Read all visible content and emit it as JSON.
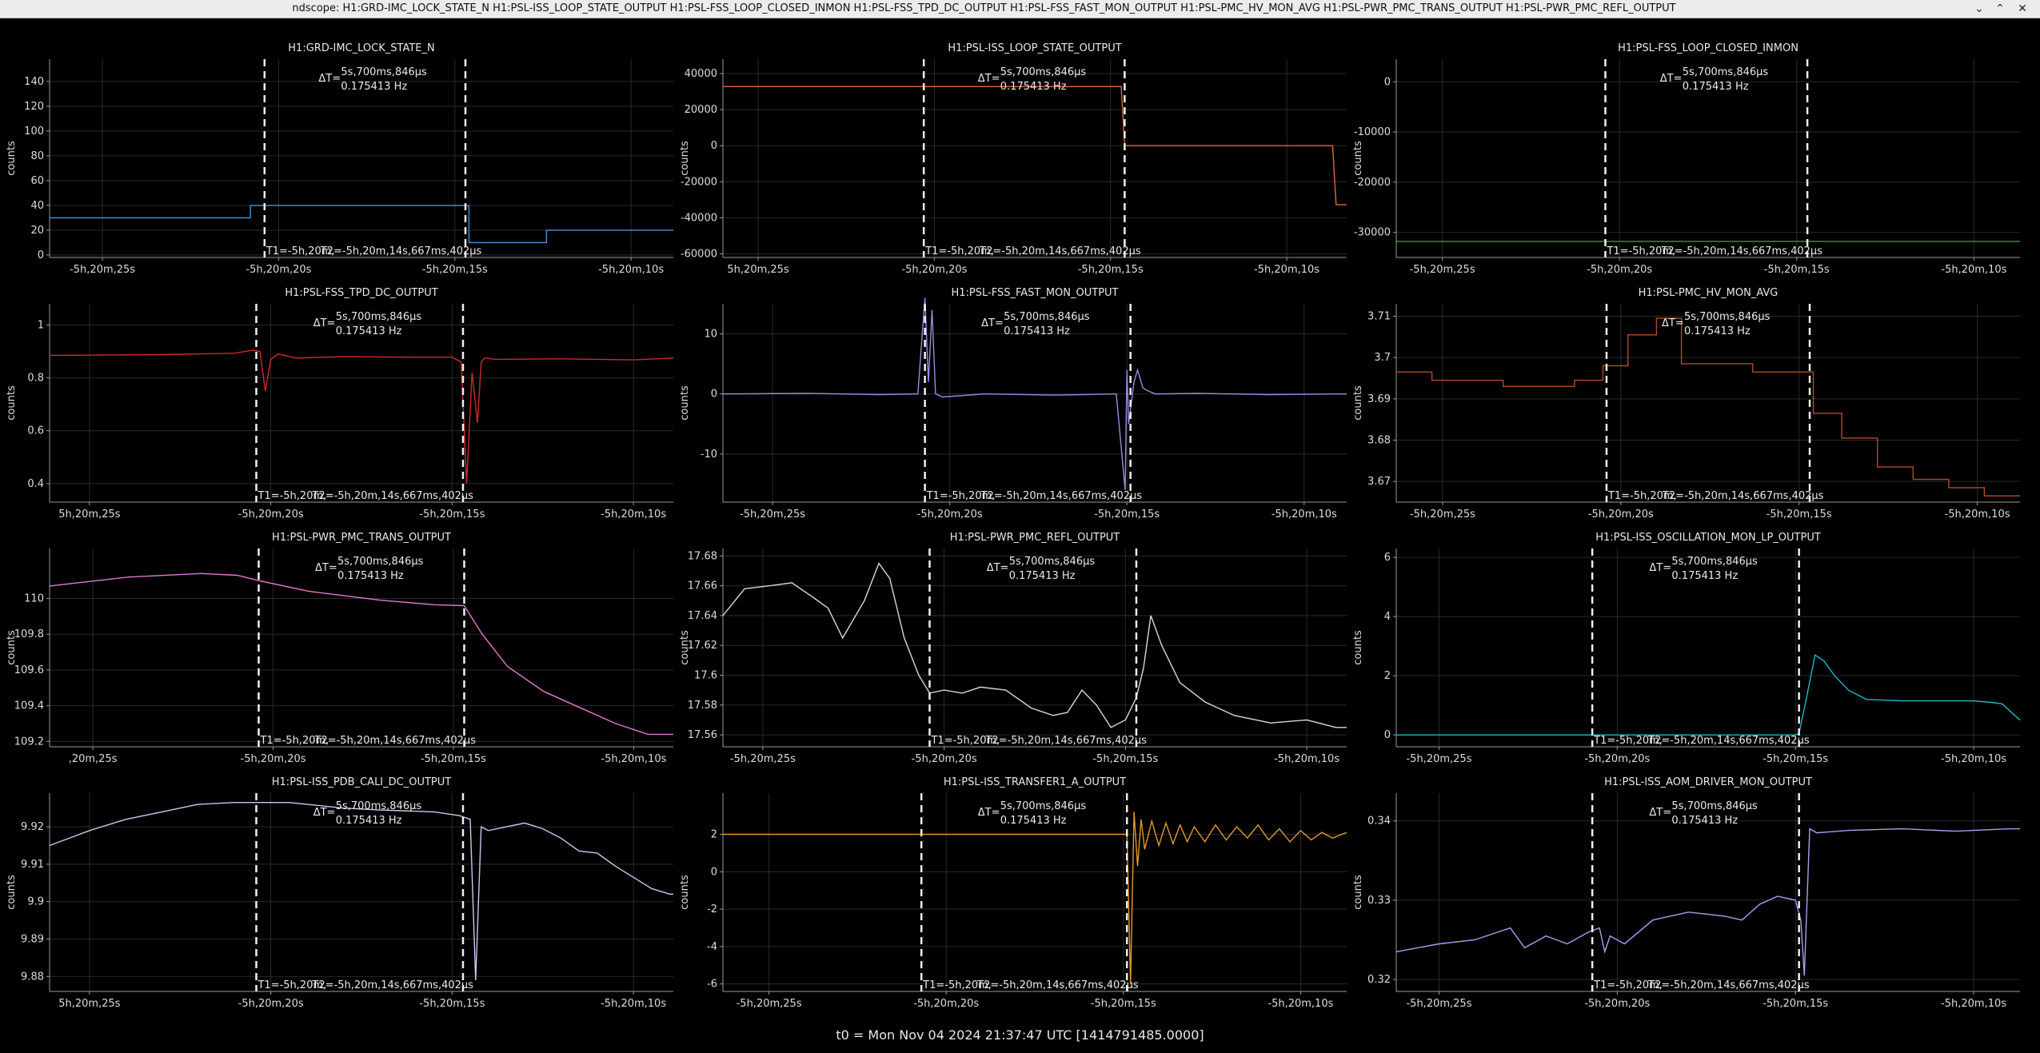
{
  "window": {
    "title": "ndscope: H1:GRD-IMC_LOCK_STATE_N H1:PSL-ISS_LOOP_STATE_OUTPUT H1:PSL-FSS_LOOP_CLOSED_INMON H1:PSL-FSS_TPD_DC_OUTPUT H1:PSL-FSS_FAST_MON_OUTPUT H1:PSL-PMC_HV_MON_AVG H1:PSL-PWR_PMC_TRANS_OUTPUT H1:PSL-PWR_PMC_REFL_OUTPUT",
    "buttons": {
      "minimize": "⌄",
      "maximize": "⌃",
      "close": "✕"
    }
  },
  "cursor_labels": {
    "dt_label": "ΔT=",
    "dt_value": "5s,700ms,846μs",
    "freq_value": "0.175413 Hz",
    "t1_label": "T1=-5h,20m,",
    "t2_label": "T2=-5h,20m,14s,667ms,402μs"
  },
  "footer": "t0 = Mon Nov 04 2024 21:37:47 UTC [1414791485.0000]",
  "chart_data": [
    {
      "type": "line",
      "title": "H1:GRD-IMC_LOCK_STATE_N",
      "ylabel": "counts",
      "color": "#4a90d9",
      "step": true,
      "ylim": [
        -2,
        158
      ],
      "yticks": [
        0,
        20,
        40,
        60,
        80,
        100,
        120,
        140
      ],
      "xlim": [
        -26.5,
        -8.8
      ],
      "xticks": [
        -25,
        -20,
        -15,
        -10
      ],
      "xtick_labels": [
        "-5h,20m,25s",
        "-5h,20m,20s",
        "-5h,20m,15s",
        "-5h,20m,10s"
      ],
      "cursors": [
        -20.4,
        -14.7
      ],
      "x": [
        -26.5,
        -20.8,
        -20.8,
        -14.6,
        -14.6,
        -12.4,
        -12.4,
        -8.8
      ],
      "y": [
        30,
        30,
        40,
        40,
        10,
        10,
        20,
        20
      ]
    },
    {
      "type": "line",
      "title": "H1:PSL-ISS_LOOP_STATE_OUTPUT",
      "ylabel": "counts",
      "color": "#e06a3c",
      "step": true,
      "ylim": [
        -62000,
        48000
      ],
      "yticks": [
        -60000,
        -40000,
        -20000,
        0,
        20000,
        40000
      ],
      "xlim": [
        -26,
        -8.3
      ],
      "xticks": [
        -25,
        -20,
        -15,
        -10
      ],
      "xtick_labels": [
        "5h,20m,25s",
        "-5h,20m,20s",
        "-5h,20m,15s",
        "-5h,20m,10s"
      ],
      "cursors": [
        -20.3,
        -14.6
      ],
      "x": [
        -26,
        -14.7,
        -14.6,
        -8.7,
        -8.6,
        -8.3
      ],
      "y": [
        32768,
        32768,
        0,
        0,
        -32768,
        -32768
      ]
    },
    {
      "type": "line",
      "title": "H1:PSL-FSS_LOOP_CLOSED_INMON",
      "ylabel": "counts",
      "color": "#3d9a3d",
      "step": false,
      "ylim": [
        -35000,
        4500
      ],
      "yticks": [
        -30000,
        -20000,
        -10000,
        0
      ],
      "xlim": [
        -26.3,
        -8.7
      ],
      "xticks": [
        -25,
        -20,
        -15,
        -10
      ],
      "xtick_labels": [
        "-5h,20m,25s",
        "-5h,20m,20s",
        "-5h,20m,15s",
        "-5h,20m,10s"
      ],
      "cursors": [
        -20.4,
        -14.7
      ],
      "x": [
        -26.3,
        -8.7
      ],
      "y": [
        -31800,
        -31800
      ]
    },
    {
      "type": "line",
      "title": "H1:PSL-FSS_TPD_DC_OUTPUT",
      "ylabel": "counts",
      "color": "#d02a2a",
      "step": false,
      "ylim": [
        0.33,
        1.08
      ],
      "yticks": [
        0.4,
        0.6,
        0.8,
        1
      ],
      "xlim": [
        -26.1,
        -8.9
      ],
      "xticks": [
        -25,
        -20,
        -15,
        -10
      ],
      "xtick_labels": [
        "5h,20m,25s",
        "-5h,20m,20s",
        "-5h,20m,15s",
        "-5h,20m,10s"
      ],
      "cursors": [
        -20.4,
        -14.7
      ],
      "x": [
        -26.1,
        -23,
        -21,
        -20.5,
        -20.3,
        -20.15,
        -20.0,
        -19.8,
        -19.3,
        -18,
        -16,
        -15,
        -14.75,
        -14.6,
        -14.45,
        -14.3,
        -14.2,
        -14.1,
        -13.8,
        -12,
        -10,
        -8.9
      ],
      "y": [
        0.885,
        0.888,
        0.893,
        0.905,
        0.9,
        0.75,
        0.87,
        0.89,
        0.875,
        0.88,
        0.878,
        0.878,
        0.86,
        0.4,
        0.82,
        0.63,
        0.86,
        0.875,
        0.87,
        0.872,
        0.868,
        0.875
      ]
    },
    {
      "type": "line",
      "title": "H1:PSL-FSS_FAST_MON_OUTPUT",
      "ylabel": "counts",
      "color": "#a088e0",
      "step": false,
      "ylim": [
        -18,
        15
      ],
      "yticks": [
        -10,
        0,
        10
      ],
      "xlim": [
        -26.4,
        -8.8
      ],
      "xticks": [
        -25,
        -20,
        -15,
        -10
      ],
      "xtick_labels": [
        "-5h,20m,25s",
        "-5h,20m,20s",
        "-5h,20m,15s",
        "-5h,20m,10s"
      ],
      "cursors": [
        -20.7,
        -14.9
      ],
      "x": [
        -26.4,
        -24,
        -22,
        -20.9,
        -20.7,
        -20.6,
        -20.5,
        -20.4,
        -20.2,
        -19,
        -17,
        -15.3,
        -15.05,
        -15.0,
        -14.95,
        -14.8,
        -14.7,
        -14.55,
        -14.4,
        -14.2,
        -13,
        -11,
        -8.8
      ],
      "y": [
        0,
        0.1,
        -0.1,
        0,
        16,
        2,
        14,
        0,
        -0.5,
        0,
        -0.2,
        0,
        -16,
        4,
        -5,
        2,
        4,
        1,
        0.5,
        0,
        0.1,
        -0.1,
        0
      ]
    },
    {
      "type": "line",
      "title": "H1:PSL-PMC_HV_MON_AVG",
      "ylabel": "counts",
      "color": "#b24a2a",
      "step": true,
      "ylim": [
        3.665,
        3.713
      ],
      "yticks": [
        3.67,
        3.68,
        3.69,
        3.7,
        3.71
      ],
      "xlim": [
        -26.3,
        -8.8
      ],
      "xticks": [
        -25,
        -20,
        -15,
        -10
      ],
      "xtick_labels": [
        "-5h,20m,25s",
        "-5h,20m,20s",
        "-5h,20m,15s",
        "-5h,20m,10s"
      ],
      "cursors": [
        -20.4,
        -14.7
      ],
      "x": [
        -26.3,
        -25.3,
        -25.3,
        -23.3,
        -23.3,
        -21.3,
        -21.3,
        -20.5,
        -20.5,
        -19.8,
        -19.8,
        -19,
        -19,
        -18.3,
        -18.3,
        -16.3,
        -16.3,
        -14.6,
        -14.6,
        -13.8,
        -13.8,
        -12.8,
        -12.8,
        -11.8,
        -11.8,
        -10.8,
        -10.8,
        -9.8,
        -9.8,
        -8.8
      ],
      "y": [
        3.6965,
        3.6965,
        3.6945,
        3.6945,
        3.693,
        3.693,
        3.6945,
        3.6945,
        3.698,
        3.698,
        3.7055,
        3.7055,
        3.7095,
        3.7095,
        3.6985,
        3.6985,
        3.6965,
        3.6965,
        3.6865,
        3.6865,
        3.6805,
        3.6805,
        3.6735,
        3.6735,
        3.6705,
        3.6705,
        3.6685,
        3.6685,
        3.6665,
        3.6665
      ]
    },
    {
      "type": "line",
      "title": "H1:PSL-PWR_PMC_TRANS_OUTPUT",
      "ylabel": "counts",
      "color": "#e07ad0",
      "step": false,
      "ylim": [
        109.17,
        110.28
      ],
      "yticks": [
        109.2,
        109.4,
        109.6,
        109.8,
        110
      ],
      "xlim": [
        -26.2,
        -8.9
      ],
      "xticks": [
        -25,
        -20,
        -15,
        -10
      ],
      "xtick_labels": [
        ",20m,25s",
        "-5h,20m,20s",
        "-5h,20m,15s",
        "-5h,20m,10s"
      ],
      "cursors": [
        -20.4,
        -14.7
      ],
      "x": [
        -26.2,
        -24,
        -22,
        -21,
        -20.4,
        -19,
        -17,
        -15.5,
        -14.7,
        -14.2,
        -13.5,
        -12.5,
        -11.5,
        -10.5,
        -9.6,
        -8.9
      ],
      "y": [
        110.07,
        110.12,
        110.14,
        110.13,
        110.1,
        110.04,
        109.99,
        109.965,
        109.96,
        109.8,
        109.62,
        109.48,
        109.39,
        109.3,
        109.24,
        109.24
      ]
    },
    {
      "type": "line",
      "title": "H1:PSL-PWR_PMC_REFL_OUTPUT",
      "ylabel": "counts",
      "color": "#d8d8d8",
      "step": false,
      "ylim": [
        17.552,
        17.685
      ],
      "yticks": [
        17.56,
        17.58,
        17.6,
        17.62,
        17.64,
        17.66,
        17.68
      ],
      "xlim": [
        -26.1,
        -8.9
      ],
      "xticks": [
        -25,
        -20,
        -15,
        -10
      ],
      "xtick_labels": [
        "-5h,20m,25s",
        "-5h,20m,20s",
        "-5h,20m,15s",
        "-5h,20m,10s"
      ],
      "cursors": [
        -20.4,
        -14.7
      ],
      "x": [
        -26.1,
        -25.5,
        -24.8,
        -24.2,
        -23.6,
        -23.2,
        -22.8,
        -22.2,
        -21.8,
        -21.5,
        -21.1,
        -20.7,
        -20.4,
        -20.0,
        -19.5,
        -19.0,
        -18.3,
        -17.6,
        -17.0,
        -16.6,
        -16.2,
        -15.8,
        -15.4,
        -15.0,
        -14.7,
        -14.5,
        -14.3,
        -14.0,
        -13.5,
        -12.8,
        -12.0,
        -11.0,
        -10.0,
        -9.2,
        -8.9
      ],
      "y": [
        17.64,
        17.658,
        17.66,
        17.662,
        17.652,
        17.645,
        17.625,
        17.65,
        17.675,
        17.665,
        17.625,
        17.6,
        17.588,
        17.59,
        17.588,
        17.592,
        17.59,
        17.578,
        17.573,
        17.575,
        17.59,
        17.58,
        17.565,
        17.57,
        17.585,
        17.605,
        17.64,
        17.62,
        17.595,
        17.582,
        17.573,
        17.568,
        17.57,
        17.565,
        17.565
      ]
    },
    {
      "type": "line",
      "title": "H1:PSL-ISS_OSCILLATION_MON_LP_OUTPUT",
      "ylabel": "counts",
      "color": "#20b8c8",
      "step": false,
      "ylim": [
        -0.4,
        6.3
      ],
      "yticks": [
        0,
        2,
        4,
        6
      ],
      "xlim": [
        -26.2,
        -8.7
      ],
      "xticks": [
        -25,
        -20,
        -15,
        -10
      ],
      "xtick_labels": [
        "-5h,20m,25s",
        "-5h,20m,20s",
        "-5h,20m,15s",
        "-5h,20m,10s"
      ],
      "cursors": [
        -20.7,
        -14.9
      ],
      "x": [
        -26.2,
        -20,
        -15,
        -14.9,
        -14.7,
        -14.45,
        -14.2,
        -13.9,
        -13.5,
        -13.0,
        -12.0,
        -11.0,
        -10.0,
        -9.5,
        -9.2,
        -8.7
      ],
      "y": [
        0,
        0,
        0,
        0.05,
        1.2,
        2.7,
        2.5,
        2.0,
        1.5,
        1.2,
        1.15,
        1.15,
        1.15,
        1.1,
        1.05,
        0.5
      ]
    },
    {
      "type": "line",
      "title": "H1:PSL-ISS_PDB_CALI_DC_OUTPUT",
      "ylabel": "counts",
      "color": "#c8c8f0",
      "step": false,
      "ylim": [
        9.876,
        9.929
      ],
      "yticks": [
        9.88,
        9.89,
        9.9,
        9.91,
        9.92
      ],
      "xlim": [
        -26.1,
        -8.9
      ],
      "xticks": [
        -25,
        -20,
        -15,
        -10
      ],
      "xtick_labels": [
        "5h,20m,25s",
        "-5h,20m,20s",
        "-5h,20m,15s",
        "-5h,20m,10s"
      ],
      "cursors": [
        -20.4,
        -14.7
      ],
      "x": [
        -26.1,
        -25,
        -24,
        -23,
        -22,
        -21,
        -20.4,
        -19.5,
        -18,
        -17,
        -15.5,
        -14.8,
        -14.5,
        -14.35,
        -14.2,
        -14.0,
        -13.5,
        -13.0,
        -12.5,
        -12.0,
        -11.5,
        -11.0,
        -10.5,
        -10.0,
        -9.5,
        -9.0,
        -8.9
      ],
      "y": [
        9.915,
        9.919,
        9.922,
        9.924,
        9.926,
        9.9265,
        9.9265,
        9.9265,
        9.925,
        9.9245,
        9.924,
        9.923,
        9.922,
        9.879,
        9.92,
        9.919,
        9.92,
        9.921,
        9.9195,
        9.917,
        9.9135,
        9.913,
        9.9095,
        9.9065,
        9.9035,
        9.902,
        9.902
      ]
    },
    {
      "type": "line",
      "title": "H1:PSL-ISS_TRANSFER1_A_OUTPUT",
      "ylabel": "counts",
      "color": "#e09a2a",
      "step": false,
      "ylim": [
        -6.4,
        4.2
      ],
      "yticks": [
        -6,
        -4,
        -2,
        0,
        2
      ],
      "xlim": [
        -26.3,
        -8.7
      ],
      "xticks": [
        -25,
        -20,
        -15,
        -10
      ],
      "xtick_labels": [
        "-5h,20m,25s",
        "-5h,20m,20s",
        "-5h,20m,15s",
        "-5h,20m,10s"
      ],
      "cursors": [
        -20.7,
        -14.9
      ],
      "x": [
        -26.3,
        -15.0,
        -14.9,
        -14.8,
        -14.7,
        -14.6,
        -14.5,
        -14.4,
        -14.2,
        -14.0,
        -13.8,
        -13.6,
        -13.4,
        -13.2,
        -13.0,
        -12.7,
        -12.4,
        -12.1,
        -11.8,
        -11.5,
        -11.2,
        -10.9,
        -10.6,
        -10.3,
        -10.0,
        -9.7,
        -9.4,
        -9.1,
        -8.7
      ],
      "y": [
        2,
        2,
        2,
        -6,
        3.2,
        0.3,
        2.8,
        1.2,
        2.7,
        1.4,
        2.6,
        1.5,
        2.5,
        1.6,
        2.4,
        1.6,
        2.5,
        1.7,
        2.4,
        1.8,
        2.5,
        1.7,
        2.3,
        1.6,
        2.2,
        1.7,
        2.1,
        1.8,
        2.1
      ]
    },
    {
      "type": "line",
      "title": "H1:PSL-ISS_AOM_DRIVER_MON_OUTPUT",
      "ylabel": "counts",
      "color": "#a7a0f0",
      "step": false,
      "ylim": [
        0.3185,
        0.3435
      ],
      "yticks": [
        0.32,
        0.33,
        0.34
      ],
      "xlim": [
        -26.2,
        -8.7
      ],
      "xticks": [
        -25,
        -20,
        -15,
        -10
      ],
      "xtick_labels": [
        "-5h,20m,25s",
        "-5h,20m,20s",
        "-5h,20m,15s",
        "-5h,20m,10s"
      ],
      "cursors": [
        -20.7,
        -14.9
      ],
      "x": [
        -26.2,
        -25,
        -24,
        -23,
        -22.6,
        -22.0,
        -21.4,
        -20.8,
        -20.5,
        -20.35,
        -20.2,
        -19.8,
        -19.0,
        -18.0,
        -17.0,
        -16.5,
        -16.0,
        -15.5,
        -15.0,
        -14.85,
        -14.75,
        -14.6,
        -14.4,
        -13.5,
        -12.0,
        -10.5,
        -9.0,
        -8.7
      ],
      "y": [
        0.3235,
        0.3245,
        0.325,
        0.3265,
        0.324,
        0.3255,
        0.3245,
        0.326,
        0.3265,
        0.3235,
        0.3255,
        0.3245,
        0.3275,
        0.3285,
        0.328,
        0.3275,
        0.3295,
        0.3305,
        0.33,
        0.3275,
        0.3205,
        0.339,
        0.3385,
        0.3388,
        0.339,
        0.3387,
        0.339,
        0.339
      ]
    }
  ]
}
